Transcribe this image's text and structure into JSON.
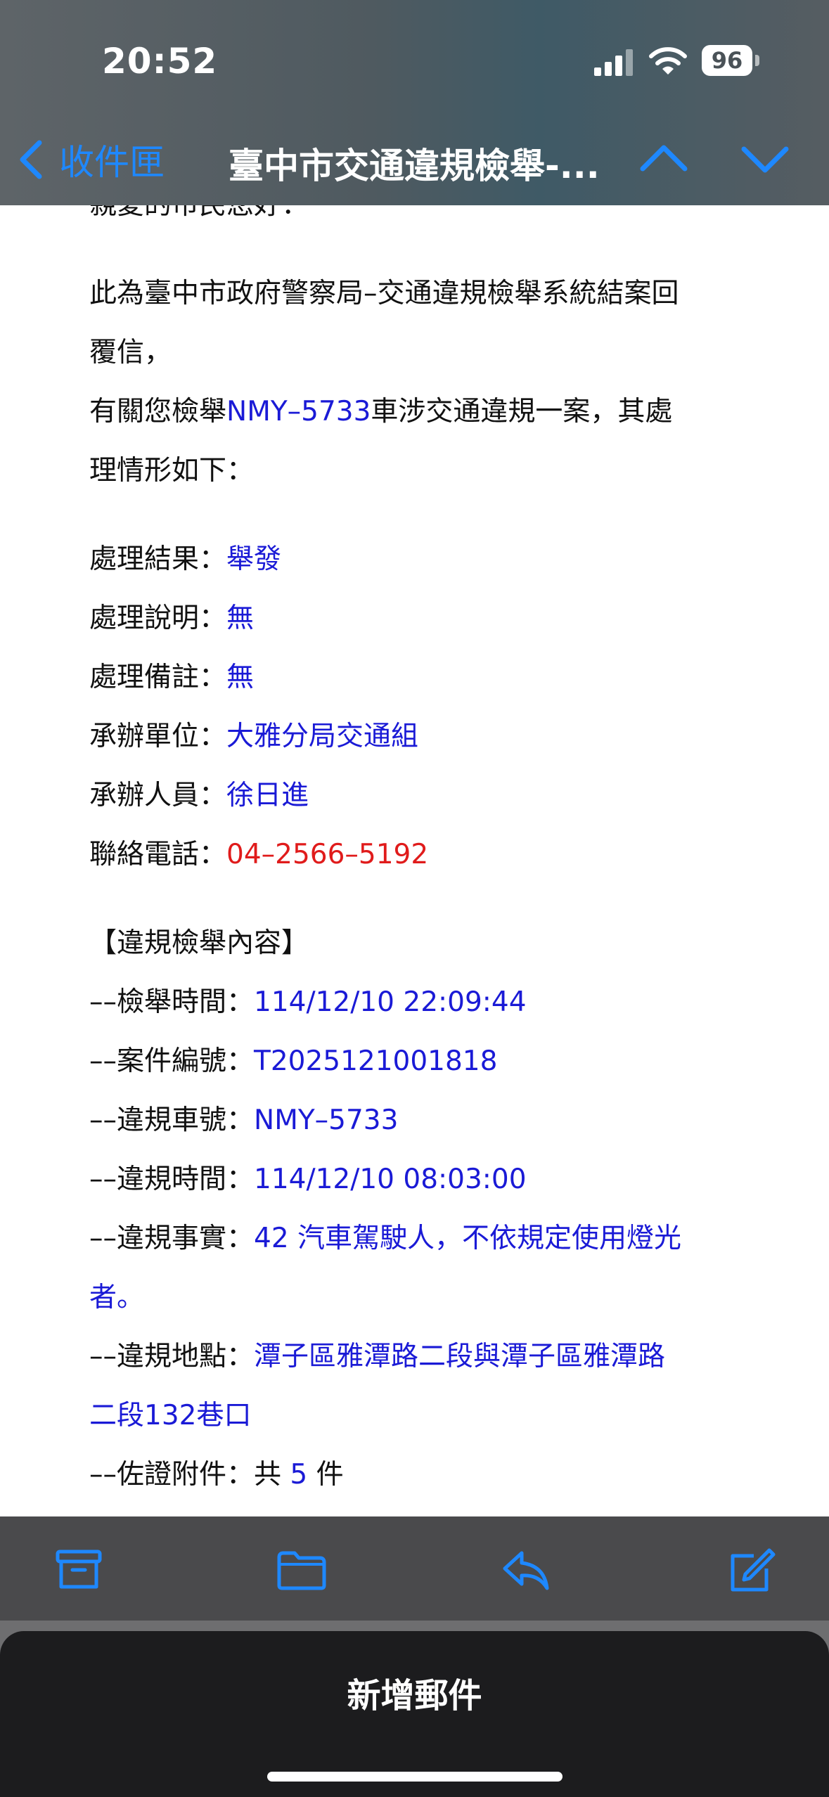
{
  "status_bar": {
    "time": "20:52",
    "battery": "96"
  },
  "nav": {
    "back_label": "收件匣",
    "title": "臺中市交通違規檢舉-..."
  },
  "email": {
    "partial_top_line": "親愛的市民您好：",
    "intro_line1": "此為臺中市政府警察局–交通違規檢舉系統結案回",
    "intro_line2": "覆信，",
    "intro_line3_prefix": "有關您檢舉",
    "intro_plate": "NMY–5733",
    "intro_line3_suffix": "車涉交通違規一案，其處",
    "intro_line4": "理情形如下：",
    "details": [
      {
        "label": "處理結果：",
        "value": "舉發"
      },
      {
        "label": "處理說明：",
        "value": "無"
      },
      {
        "label": "處理備註：",
        "value": "無"
      },
      {
        "label": "承辦單位：",
        "value": "大雅分局交通組"
      },
      {
        "label": "承辦人員：",
        "value": "徐日進"
      }
    ],
    "phone_label": "聯絡電話：",
    "phone_value": "04–2566–5192",
    "section_title": "【違規檢舉內容】",
    "report": [
      {
        "label": "––檢舉時間：",
        "value": "114/12/10 22:09:44"
      },
      {
        "label": "––案件編號：",
        "value": "T2025121001818"
      },
      {
        "label": "––違規車號：",
        "value": "NMY–5733"
      },
      {
        "label": "––違規時間：",
        "value": "114/12/10 08:03:00"
      }
    ],
    "fact_label": "––違規事實：",
    "fact_value_line1": "42 汽車駕駛人，不依規定使用燈光",
    "fact_value_line2": "者。",
    "place_label": "––違規地點：",
    "place_value_line1": "潭子區雅潭路二段與潭子區雅潭路",
    "place_value_line2": "二段132巷口",
    "attach_label": "––佐證附件：共 ",
    "attach_count": "5",
    "attach_suffix": " 件"
  },
  "toolbar": {
    "icons": [
      "archive-icon",
      "folder-icon",
      "reply-icon",
      "compose-icon"
    ]
  },
  "new_mail": {
    "label": "新增郵件"
  },
  "colors": {
    "accent": "#1e88ff",
    "value_blue": "#1a1ad6",
    "phone_red": "#e01b1b"
  }
}
